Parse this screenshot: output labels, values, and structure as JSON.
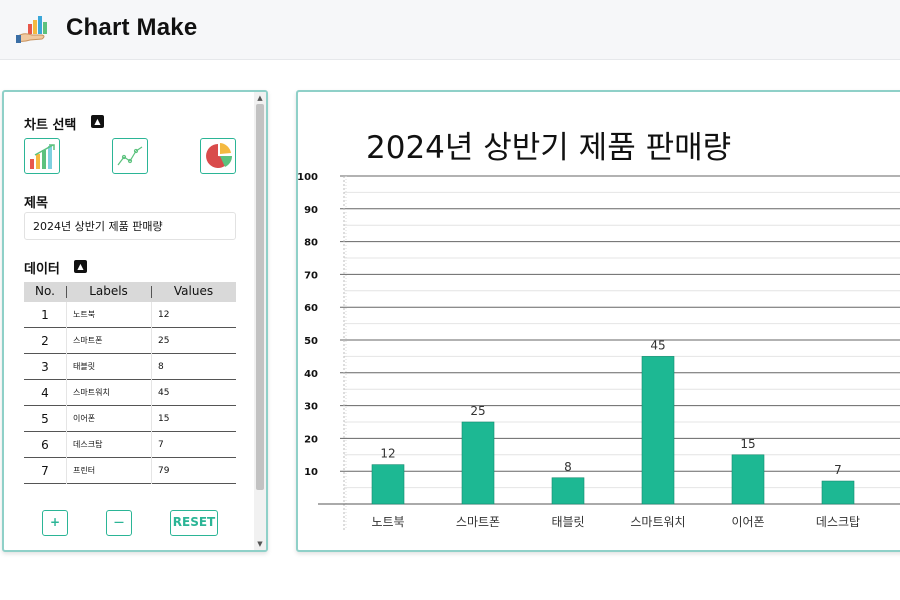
{
  "app": {
    "title": "Chart Make",
    "logo_icon": "hand-chart-logo-icon"
  },
  "sidebar": {
    "chart_select_label": "차트 선택",
    "chart_types": [
      {
        "name": "bar-chart-type-icon",
        "selected": false
      },
      {
        "name": "line-chart-type-icon",
        "selected": false
      },
      {
        "name": "pie-chart-type-icon",
        "selected": false
      }
    ],
    "title_label": "제목",
    "title_value": "2024년 상반기 제품 판매량",
    "data_label": "데이터",
    "table": {
      "headers": [
        "No.",
        "Labels",
        "Values"
      ],
      "rows": [
        {
          "no": "1",
          "label": "노트북",
          "value": "12"
        },
        {
          "no": "2",
          "label": "스마트폰",
          "value": "25"
        },
        {
          "no": "3",
          "label": "태블릿",
          "value": "8"
        },
        {
          "no": "4",
          "label": "스마트워치",
          "value": "45"
        },
        {
          "no": "5",
          "label": "이어폰",
          "value": "15"
        },
        {
          "no": "6",
          "label": "데스크탑",
          "value": "7"
        },
        {
          "no": "7",
          "label": "프린터",
          "value": "79"
        }
      ]
    },
    "buttons": {
      "add": "+",
      "remove": "—",
      "reset": "RESET"
    }
  },
  "colors": {
    "accent": "#2bb596",
    "bar": "#1db893",
    "panel_border": "#8fd0c8"
  },
  "chart_data": {
    "type": "bar",
    "title": "2024년 상반기 제품 판매량",
    "categories": [
      "노트북",
      "스마트폰",
      "태블릿",
      "스마트워치",
      "이어폰",
      "데스크탑"
    ],
    "values": [
      12,
      25,
      8,
      45,
      15,
      7
    ],
    "ylim": [
      0,
      100
    ],
    "yticks": [
      10,
      20,
      30,
      40,
      50,
      60,
      70,
      80,
      90,
      100
    ],
    "grid": true
  }
}
